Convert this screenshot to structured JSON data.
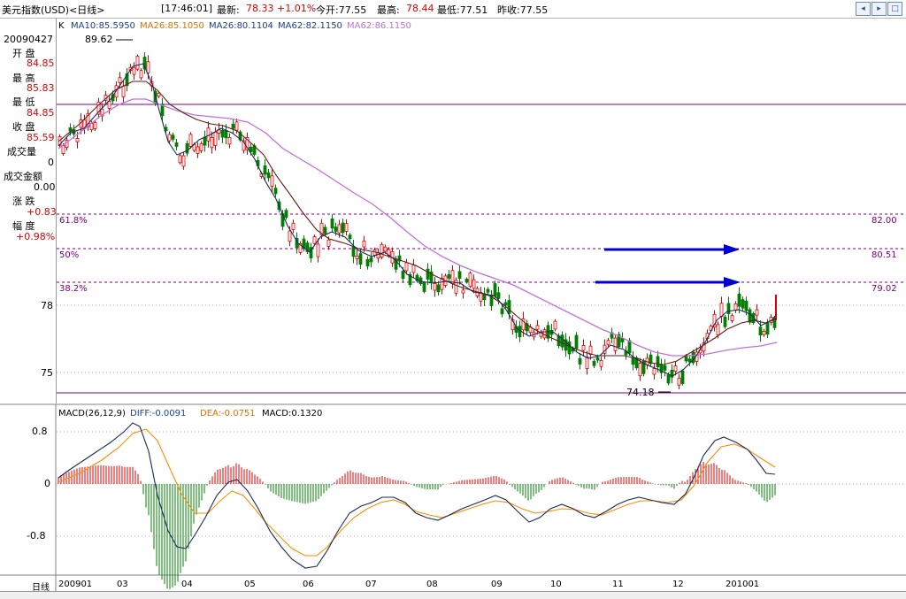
{
  "header": {
    "title": "美元指数(USD)<日线>",
    "time": "[17:46:01]",
    "latest_label": "最新:",
    "latest_value": "78.33",
    "change_pct": "+1.01%",
    "open_label": "今开:77.55",
    "high_label": "最高:",
    "high_value": "78.44",
    "low_label": "最低:77.51",
    "prevclose_label": "昨收:77.55"
  },
  "window_buttons": [
    "back-icon",
    "forward-icon",
    "expand-icon"
  ],
  "left_panel": {
    "date": "20090427",
    "open_label": "开 盘",
    "open_value": "84.85",
    "high_label": "最 高",
    "high_value": "85.83",
    "low_label": "最 低",
    "low_value": "84.85",
    "close_label": "收 盘",
    "close_value": "85.59",
    "volume_label": "成交量",
    "volume_value": "0",
    "amount_label": "成交金额",
    "amount_value": "0.00",
    "change_label": "涨 跌",
    "change_value": "+0.83",
    "amplitude_label": "幅 度",
    "amplitude_value": "+0.98%"
  },
  "ma_legend": {
    "k": "K",
    "ma10": "MA10:85.5950",
    "ma26": "MA26:85.1050",
    "ma26b": "MA26:80.1104",
    "ma62": "MA62:82.1150",
    "ma62b": "MA62:86.1150"
  },
  "price_axis": {
    "ticks": [
      "78",
      "75",
      "0"
    ]
  },
  "annotations": {
    "high_mark": "89.62",
    "low_mark": "74.18"
  },
  "fib_levels": [
    {
      "label": "61.8%",
      "value": "82.00"
    },
    {
      "label": "50%",
      "value": "80.51"
    },
    {
      "label": "38.2%",
      "value": "79.02"
    }
  ],
  "macd": {
    "header": "MACD(26,12,9)",
    "diff": "DIFF:-0.0091",
    "dea": "DEA:-0.0751",
    "macd": "MACD:0.1320",
    "axis": [
      "0.8",
      "0",
      "-0.8"
    ]
  },
  "x_axis": {
    "label": "日线",
    "months": [
      "200901",
      "03",
      "04",
      "05",
      "06",
      "07",
      "08",
      "09",
      "10",
      "11",
      "12",
      "201001"
    ]
  },
  "colors": {
    "up": "#e00000",
    "down": "#008000",
    "ma10": "#1a2a5a",
    "ma26": "#6b1a1a",
    "ma62": "#c070e0",
    "guide": "#800080",
    "arrow": "#0000d0",
    "dea": "#ff8c00"
  },
  "chart_data": {
    "type": "candlestick",
    "title": "美元指数(USD)<日线>",
    "x_labels": [
      "200901",
      "03",
      "04",
      "05",
      "06",
      "07",
      "08",
      "09",
      "10",
      "11",
      "12",
      "201001"
    ],
    "price_ticks": [
      78,
      75
    ],
    "fib_levels": [
      82.0,
      80.51,
      79.02
    ],
    "high": 89.62,
    "low": 74.18,
    "ma10_path": [
      [
        66,
        165
      ],
      [
        80,
        150
      ],
      [
        95,
        145
      ],
      [
        110,
        128
      ],
      [
        125,
        112
      ],
      [
        140,
        90
      ],
      [
        150,
        75
      ],
      [
        162,
        72
      ],
      [
        172,
        95
      ],
      [
        180,
        125
      ],
      [
        190,
        160
      ],
      [
        200,
        175
      ],
      [
        212,
        170
      ],
      [
        225,
        158
      ],
      [
        238,
        152
      ],
      [
        250,
        145
      ],
      [
        262,
        150
      ],
      [
        275,
        160
      ],
      [
        288,
        180
      ],
      [
        300,
        205
      ],
      [
        312,
        225
      ],
      [
        325,
        255
      ],
      [
        337,
        275
      ],
      [
        350,
        285
      ],
      [
        362,
        268
      ],
      [
        375,
        262
      ],
      [
        390,
        268
      ],
      [
        405,
        283
      ],
      [
        420,
        290
      ],
      [
        435,
        285
      ],
      [
        448,
        295
      ],
      [
        460,
        310
      ],
      [
        475,
        318
      ],
      [
        490,
        320
      ],
      [
        505,
        318
      ],
      [
        520,
        320
      ],
      [
        535,
        330
      ],
      [
        548,
        332
      ],
      [
        560,
        335
      ],
      [
        572,
        350
      ],
      [
        585,
        372
      ],
      [
        598,
        380
      ],
      [
        612,
        375
      ],
      [
        625,
        375
      ],
      [
        638,
        385
      ],
      [
        652,
        398
      ],
      [
        665,
        405
      ],
      [
        678,
        402
      ],
      [
        690,
        390
      ],
      [
        705,
        395
      ],
      [
        718,
        405
      ],
      [
        730,
        412
      ],
      [
        745,
        418
      ],
      [
        760,
        425
      ],
      [
        772,
        418
      ],
      [
        785,
        405
      ],
      [
        798,
        385
      ],
      [
        810,
        362
      ],
      [
        822,
        352
      ],
      [
        835,
        350
      ],
      [
        848,
        355
      ],
      [
        860,
        368
      ],
      [
        872,
        362
      ],
      [
        878,
        355
      ]
    ],
    "ma26_path": [
      [
        66,
        160
      ],
      [
        90,
        140
      ],
      [
        110,
        120
      ],
      [
        130,
        102
      ],
      [
        150,
        92
      ],
      [
        165,
        92
      ],
      [
        178,
        102
      ],
      [
        192,
        118
      ],
      [
        208,
        128
      ],
      [
        222,
        135
      ],
      [
        238,
        140
      ],
      [
        252,
        142
      ],
      [
        268,
        148
      ],
      [
        282,
        160
      ],
      [
        298,
        175
      ],
      [
        312,
        198
      ],
      [
        328,
        220
      ],
      [
        342,
        240
      ],
      [
        358,
        260
      ],
      [
        372,
        270
      ],
      [
        390,
        275
      ],
      [
        408,
        282
      ],
      [
        425,
        285
      ],
      [
        440,
        290
      ],
      [
        455,
        295
      ],
      [
        470,
        300
      ],
      [
        488,
        310
      ],
      [
        505,
        318
      ],
      [
        522,
        325
      ],
      [
        540,
        330
      ],
      [
        555,
        335
      ],
      [
        570,
        345
      ],
      [
        585,
        358
      ],
      [
        600,
        370
      ],
      [
        615,
        378
      ],
      [
        630,
        385
      ],
      [
        645,
        392
      ],
      [
        660,
        398
      ],
      [
        675,
        402
      ],
      [
        690,
        402
      ],
      [
        705,
        402
      ],
      [
        720,
        405
      ],
      [
        735,
        410
      ],
      [
        750,
        412
      ],
      [
        765,
        408
      ],
      [
        778,
        400
      ],
      [
        792,
        392
      ],
      [
        808,
        382
      ],
      [
        822,
        372
      ],
      [
        838,
        365
      ],
      [
        852,
        362
      ],
      [
        865,
        365
      ],
      [
        878,
        360
      ]
    ],
    "ma62_path": [
      [
        66,
        168
      ],
      [
        90,
        150
      ],
      [
        115,
        130
      ],
      [
        135,
        118
      ],
      [
        150,
        112
      ],
      [
        165,
        112
      ],
      [
        180,
        118
      ],
      [
        200,
        125
      ],
      [
        220,
        130
      ],
      [
        240,
        132
      ],
      [
        260,
        134
      ],
      [
        280,
        138
      ],
      [
        300,
        150
      ],
      [
        320,
        168
      ],
      [
        340,
        180
      ],
      [
        360,
        192
      ],
      [
        380,
        205
      ],
      [
        400,
        218
      ],
      [
        420,
        230
      ],
      [
        440,
        245
      ],
      [
        460,
        262
      ],
      [
        480,
        278
      ],
      [
        500,
        290
      ],
      [
        520,
        300
      ],
      [
        540,
        308
      ],
      [
        560,
        315
      ],
      [
        580,
        322
      ],
      [
        600,
        332
      ],
      [
        620,
        342
      ],
      [
        640,
        352
      ],
      [
        660,
        362
      ],
      [
        680,
        372
      ],
      [
        700,
        380
      ],
      [
        720,
        390
      ],
      [
        740,
        398
      ],
      [
        760,
        402
      ],
      [
        780,
        402
      ],
      [
        800,
        400
      ],
      [
        820,
        396
      ],
      [
        840,
        393
      ],
      [
        860,
        391
      ],
      [
        878,
        387
      ]
    ],
    "macd_diff_path": [
      [
        66,
        540
      ],
      [
        80,
        530
      ],
      [
        95,
        520
      ],
      [
        110,
        510
      ],
      [
        125,
        500
      ],
      [
        140,
        488
      ],
      [
        150,
        478
      ],
      [
        158,
        482
      ],
      [
        168,
        510
      ],
      [
        178,
        560
      ],
      [
        190,
        600
      ],
      [
        200,
        618
      ],
      [
        210,
        620
      ],
      [
        220,
        605
      ],
      [
        232,
        585
      ],
      [
        245,
        560
      ],
      [
        258,
        545
      ],
      [
        268,
        542
      ],
      [
        280,
        555
      ],
      [
        292,
        575
      ],
      [
        305,
        600
      ],
      [
        318,
        618
      ],
      [
        330,
        632
      ],
      [
        345,
        642
      ],
      [
        358,
        640
      ],
      [
        370,
        622
      ],
      [
        382,
        600
      ],
      [
        395,
        580
      ],
      [
        408,
        572
      ],
      [
        420,
        568
      ],
      [
        432,
        562
      ],
      [
        445,
        562
      ],
      [
        458,
        568
      ],
      [
        470,
        580
      ],
      [
        482,
        585
      ],
      [
        495,
        588
      ],
      [
        508,
        582
      ],
      [
        522,
        575
      ],
      [
        535,
        570
      ],
      [
        548,
        565
      ],
      [
        560,
        560
      ],
      [
        572,
        565
      ],
      [
        585,
        578
      ],
      [
        598,
        590
      ],
      [
        610,
        585
      ],
      [
        622,
        575
      ],
      [
        635,
        570
      ],
      [
        648,
        575
      ],
      [
        660,
        582
      ],
      [
        672,
        585
      ],
      [
        685,
        578
      ],
      [
        698,
        570
      ],
      [
        710,
        565
      ],
      [
        722,
        562
      ],
      [
        735,
        565
      ],
      [
        748,
        568
      ],
      [
        762,
        570
      ],
      [
        775,
        558
      ],
      [
        785,
        538
      ],
      [
        795,
        515
      ],
      [
        808,
        498
      ],
      [
        818,
        494
      ],
      [
        832,
        500
      ],
      [
        845,
        508
      ],
      [
        855,
        520
      ],
      [
        866,
        535
      ],
      [
        876,
        536
      ]
    ],
    "macd_dea_path": [
      [
        66,
        545
      ],
      [
        90,
        535
      ],
      [
        115,
        520
      ],
      [
        135,
        505
      ],
      [
        150,
        490
      ],
      [
        165,
        485
      ],
      [
        178,
        498
      ],
      [
        190,
        525
      ],
      [
        205,
        558
      ],
      [
        220,
        580
      ],
      [
        235,
        580
      ],
      [
        250,
        565
      ],
      [
        262,
        555
      ],
      [
        275,
        560
      ],
      [
        288,
        575
      ],
      [
        300,
        590
      ],
      [
        315,
        605
      ],
      [
        330,
        620
      ],
      [
        345,
        628
      ],
      [
        358,
        628
      ],
      [
        370,
        618
      ],
      [
        385,
        600
      ],
      [
        400,
        585
      ],
      [
        415,
        575
      ],
      [
        430,
        568
      ],
      [
        445,
        565
      ],
      [
        458,
        570
      ],
      [
        470,
        578
      ],
      [
        485,
        582
      ],
      [
        500,
        585
      ],
      [
        515,
        580
      ],
      [
        530,
        575
      ],
      [
        545,
        570
      ],
      [
        560,
        566
      ],
      [
        575,
        568
      ],
      [
        590,
        575
      ],
      [
        605,
        580
      ],
      [
        620,
        578
      ],
      [
        635,
        575
      ],
      [
        650,
        576
      ],
      [
        665,
        580
      ],
      [
        680,
        582
      ],
      [
        695,
        576
      ],
      [
        710,
        570
      ],
      [
        725,
        566
      ],
      [
        740,
        566
      ],
      [
        755,
        568
      ],
      [
        770,
        565
      ],
      [
        785,
        548
      ],
      [
        800,
        522
      ],
      [
        815,
        505
      ],
      [
        830,
        502
      ],
      [
        845,
        508
      ],
      [
        860,
        518
      ],
      [
        876,
        528
      ]
    ]
  }
}
